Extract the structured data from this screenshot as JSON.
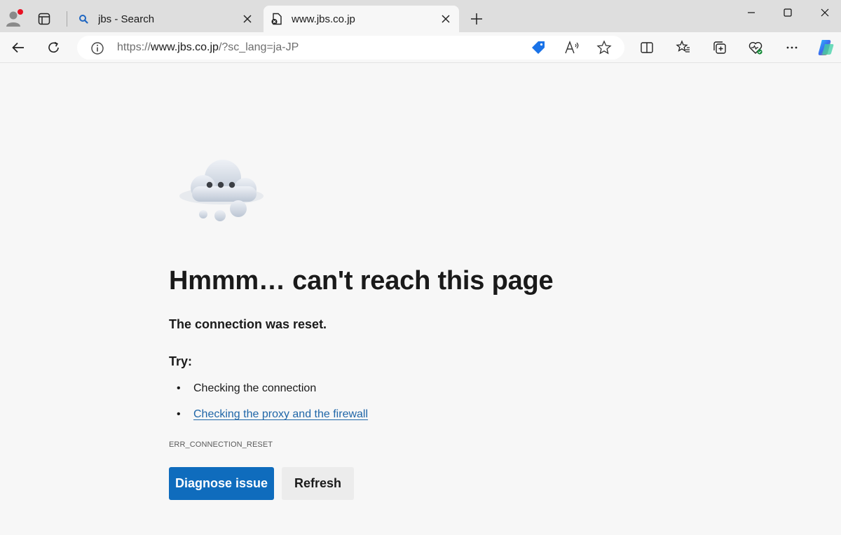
{
  "browser": {
    "tabs": [
      {
        "title": "jbs - Search",
        "icon": "search-icon"
      },
      {
        "title": "www.jbs.co.jp",
        "icon": "error-page-icon"
      }
    ],
    "address": {
      "scheme": "https://",
      "host": "www.jbs.co.jp",
      "path": "/?sc_lang=ja-JP"
    },
    "accent_color": "#0f6cbd"
  },
  "error_page": {
    "headline": "Hmmm… can't reach this page",
    "message": "The connection was reset.",
    "try_label": "Try:",
    "suggestions": [
      {
        "text": "Checking the connection"
      },
      {
        "text": "Checking the proxy and the firewall"
      }
    ],
    "error_code": "ERR_CONNECTION_RESET",
    "buttons": {
      "diagnose": "Diagnose issue",
      "refresh": "Refresh"
    }
  }
}
